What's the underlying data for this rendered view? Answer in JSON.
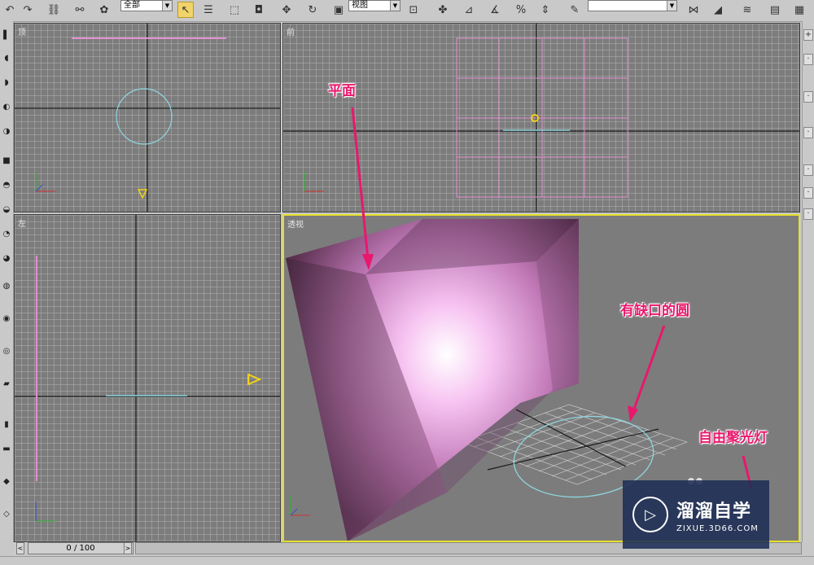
{
  "toolbar": {
    "selection_filter": "全部",
    "reference_coord": "视图",
    "named_selection": ""
  },
  "viewports": {
    "top": {
      "label": "顶"
    },
    "front": {
      "label": "前"
    },
    "left": {
      "label": "左"
    },
    "perspective": {
      "label": "透视"
    }
  },
  "annotations": {
    "plane": "平面",
    "circle": "有缺口的圆",
    "spotlight": "自由聚光灯"
  },
  "timeline": {
    "frame": "0 / 100",
    "prev": "<",
    "next": ">"
  },
  "watermark": {
    "name": "溜溜自学",
    "url": "ZIXUE.3D66.COM"
  },
  "colors": {
    "annotation": "#e8186c",
    "active_viewport_border": "#e6df2a",
    "plane_wire": "#e08fd0",
    "circle_wire": "#8fd6e0",
    "light": "#f2d21a"
  }
}
